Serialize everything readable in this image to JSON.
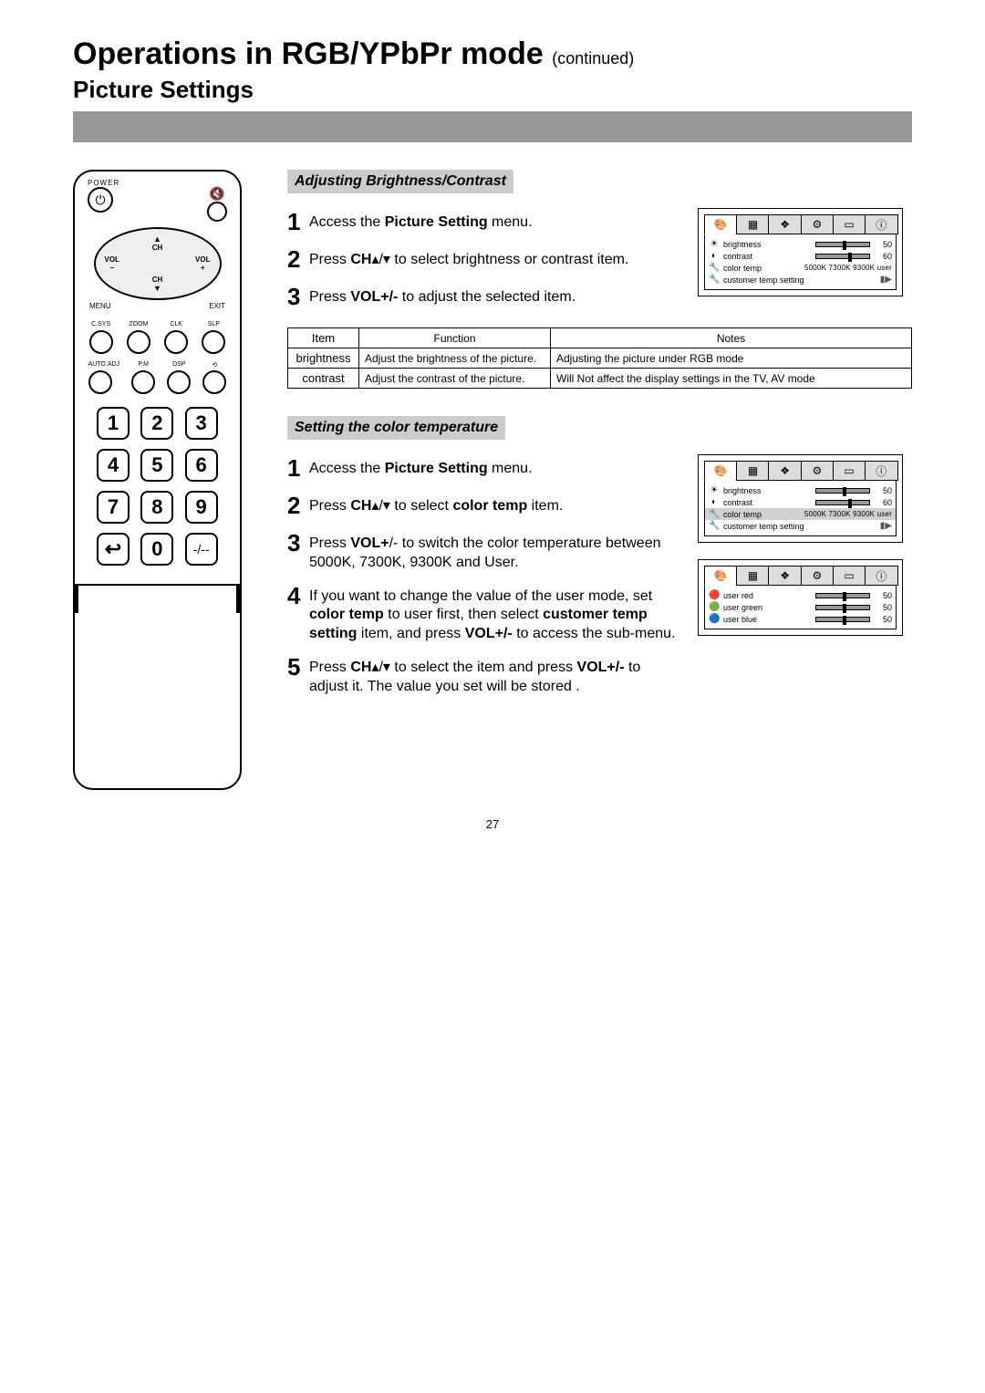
{
  "title_main": "Operations in RGB/YPbPr mode",
  "title_cont": "(continued)",
  "section_title": "Picture Settings",
  "page_number": "27",
  "remote": {
    "power": "POWER",
    "menu": "MENU",
    "exit": "EXIT",
    "ch": "CH",
    "vol": "VOL",
    "row1": [
      "C.SYS",
      "ZOOM",
      "CLK",
      "SLP"
    ],
    "row2": [
      "AUTO.ADJ",
      "P.M",
      "DSP",
      ""
    ],
    "keys": [
      "1",
      "2",
      "3",
      "4",
      "5",
      "6",
      "7",
      "8",
      "9",
      "↩",
      "0",
      "-/--"
    ]
  },
  "sec1": {
    "heading": "Adjusting Brightness/Contrast",
    "steps": [
      {
        "n": "1",
        "pre": "Access the ",
        "b1": "Picture Setting",
        "post": " menu."
      },
      {
        "n": "2",
        "pre": "Press ",
        "b1": "CH",
        "mid": "▴/▾ to select brightness or contrast item."
      },
      {
        "n": "3",
        "pre": "Press ",
        "b1": "VOL+/-",
        "post": " to adjust the selected item."
      }
    ],
    "table": {
      "headers": [
        "Item",
        "Function",
        "Notes"
      ],
      "rows": [
        {
          "item": "brightness",
          "fn": "Adjust the brightness of the picture.",
          "notes": "Adjusting the picture under RGB mode"
        },
        {
          "item": "contrast",
          "fn": "Adjust the contrast of the picture.",
          "notes": "Will Not affect the display settings in the TV, AV mode"
        }
      ]
    }
  },
  "sec2": {
    "heading": "Setting the color temperature",
    "steps": [
      {
        "n": "1",
        "html": "Access the <b>Picture Setting</b> menu."
      },
      {
        "n": "2",
        "html": "Press <b>CH</b>▴/▾  to select <b>color temp</b> item."
      },
      {
        "n": "3",
        "html": "Press <b>VOL+</b>/- to switch the color temperature between 5000K, 7300K, 9300K and User."
      },
      {
        "n": "4",
        "html": "If you want to change the value of the user mode, set <b>color temp</b> to user first, then select <b>customer temp setting</b> item, and press <b>VOL+/-</b> to access the sub-menu."
      },
      {
        "n": "5",
        "html": "Press <b>CH</b>▴/▾  to select the item and press <b>VOL+/-</b> to adjust it. The value you set will be stored ."
      }
    ]
  },
  "osd_main": {
    "tabs": [
      "🎨",
      "▦",
      "❖",
      "⚙",
      "▭",
      "ⓘ"
    ],
    "rows": [
      {
        "icon": "☀",
        "label": "brightness",
        "val": "50",
        "bar": 50
      },
      {
        "icon": "◐",
        "label": "contrast",
        "val": "60",
        "bar": 60
      },
      {
        "icon": "🔧",
        "label": "color temp",
        "opts": "5000K  7300K  9300K  user"
      },
      {
        "icon": "🔧",
        "label": "customer temp setting",
        "arrow": true
      }
    ]
  },
  "osd_main2": {
    "tabs": [
      "🎨",
      "▦",
      "❖",
      "⚙",
      "▭",
      "ⓘ"
    ],
    "rows": [
      {
        "icon": "☀",
        "label": "brightness",
        "val": "50",
        "bar": 50
      },
      {
        "icon": "◐",
        "label": "contrast",
        "val": "60",
        "bar": 60
      },
      {
        "icon": "🔧",
        "label": "color temp",
        "opts": "5000K  7300K  9300K  user",
        "selected": true
      },
      {
        "icon": "🔧",
        "label": "customer temp setting",
        "arrow": true
      }
    ]
  },
  "osd_user": {
    "tabs": [
      "🎨",
      "▦",
      "❖",
      "⚙",
      "▭",
      "ⓘ"
    ],
    "rows": [
      {
        "icon": "🔴",
        "label": "user red",
        "val": "50",
        "bar": 50
      },
      {
        "icon": "🟢",
        "label": "user green",
        "val": "50",
        "bar": 50
      },
      {
        "icon": "🔵",
        "label": "user blue",
        "val": "50",
        "bar": 50
      }
    ]
  }
}
